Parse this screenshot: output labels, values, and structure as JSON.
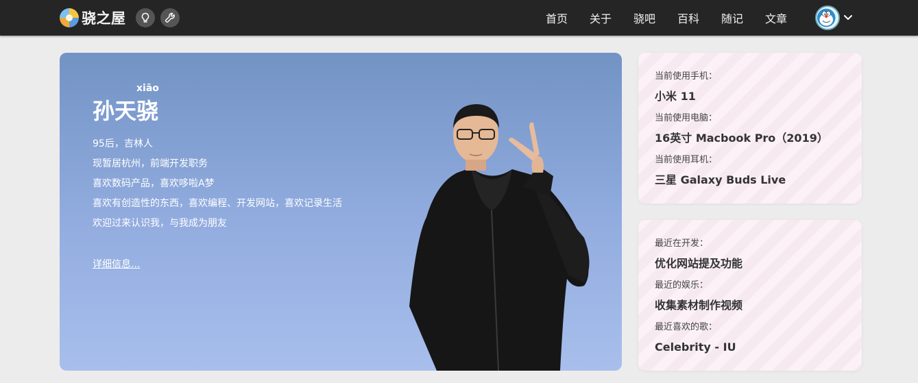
{
  "site": {
    "logo_text": "骁之屋",
    "icons": {
      "logo": "site-logo-icon",
      "idea": "lightbulb-icon",
      "tools": "wrench-icon",
      "avatar": "doraemon-avatar-icon",
      "dropdown": "chevron-down-icon"
    }
  },
  "nav": {
    "items": [
      {
        "label": "首页"
      },
      {
        "label": "关于"
      },
      {
        "label": "骁吧"
      },
      {
        "label": "百科"
      },
      {
        "label": "随记"
      },
      {
        "label": "文章"
      }
    ]
  },
  "hero": {
    "pinyin": "xiāo",
    "name": "孙天骁",
    "bio": [
      "95后，吉林人",
      "现暂居杭州，前端开发职务",
      "喜欢数码产品，喜欢哆啦A梦",
      "喜欢有创造性的东西，喜欢编程、开发网站，喜欢记录生活",
      "欢迎过来认识我，与我成为朋友"
    ],
    "detail_link": "详细信息...",
    "background_colors": [
      "#7393c5",
      "#a8bfec"
    ]
  },
  "devices": {
    "entries": [
      {
        "label": "当前使用手机：",
        "value": "小米 11"
      },
      {
        "label": "当前使用电脑：",
        "value": "16英寸 Macbook Pro（2019）"
      },
      {
        "label": "当前使用耳机：",
        "value": "三星 Galaxy Buds Live"
      }
    ]
  },
  "recent": {
    "entries": [
      {
        "label": "最近在开发：",
        "value": "优化网站提及功能"
      },
      {
        "label": "最近的娱乐：",
        "value": "收集素材制作视频"
      },
      {
        "label": "最近喜欢的歌：",
        "value": "Celebrity - IU"
      }
    ]
  },
  "colors": {
    "topbar": "#252525",
    "page_bg": "#ececec",
    "card_bg": "#fbf1f6"
  }
}
